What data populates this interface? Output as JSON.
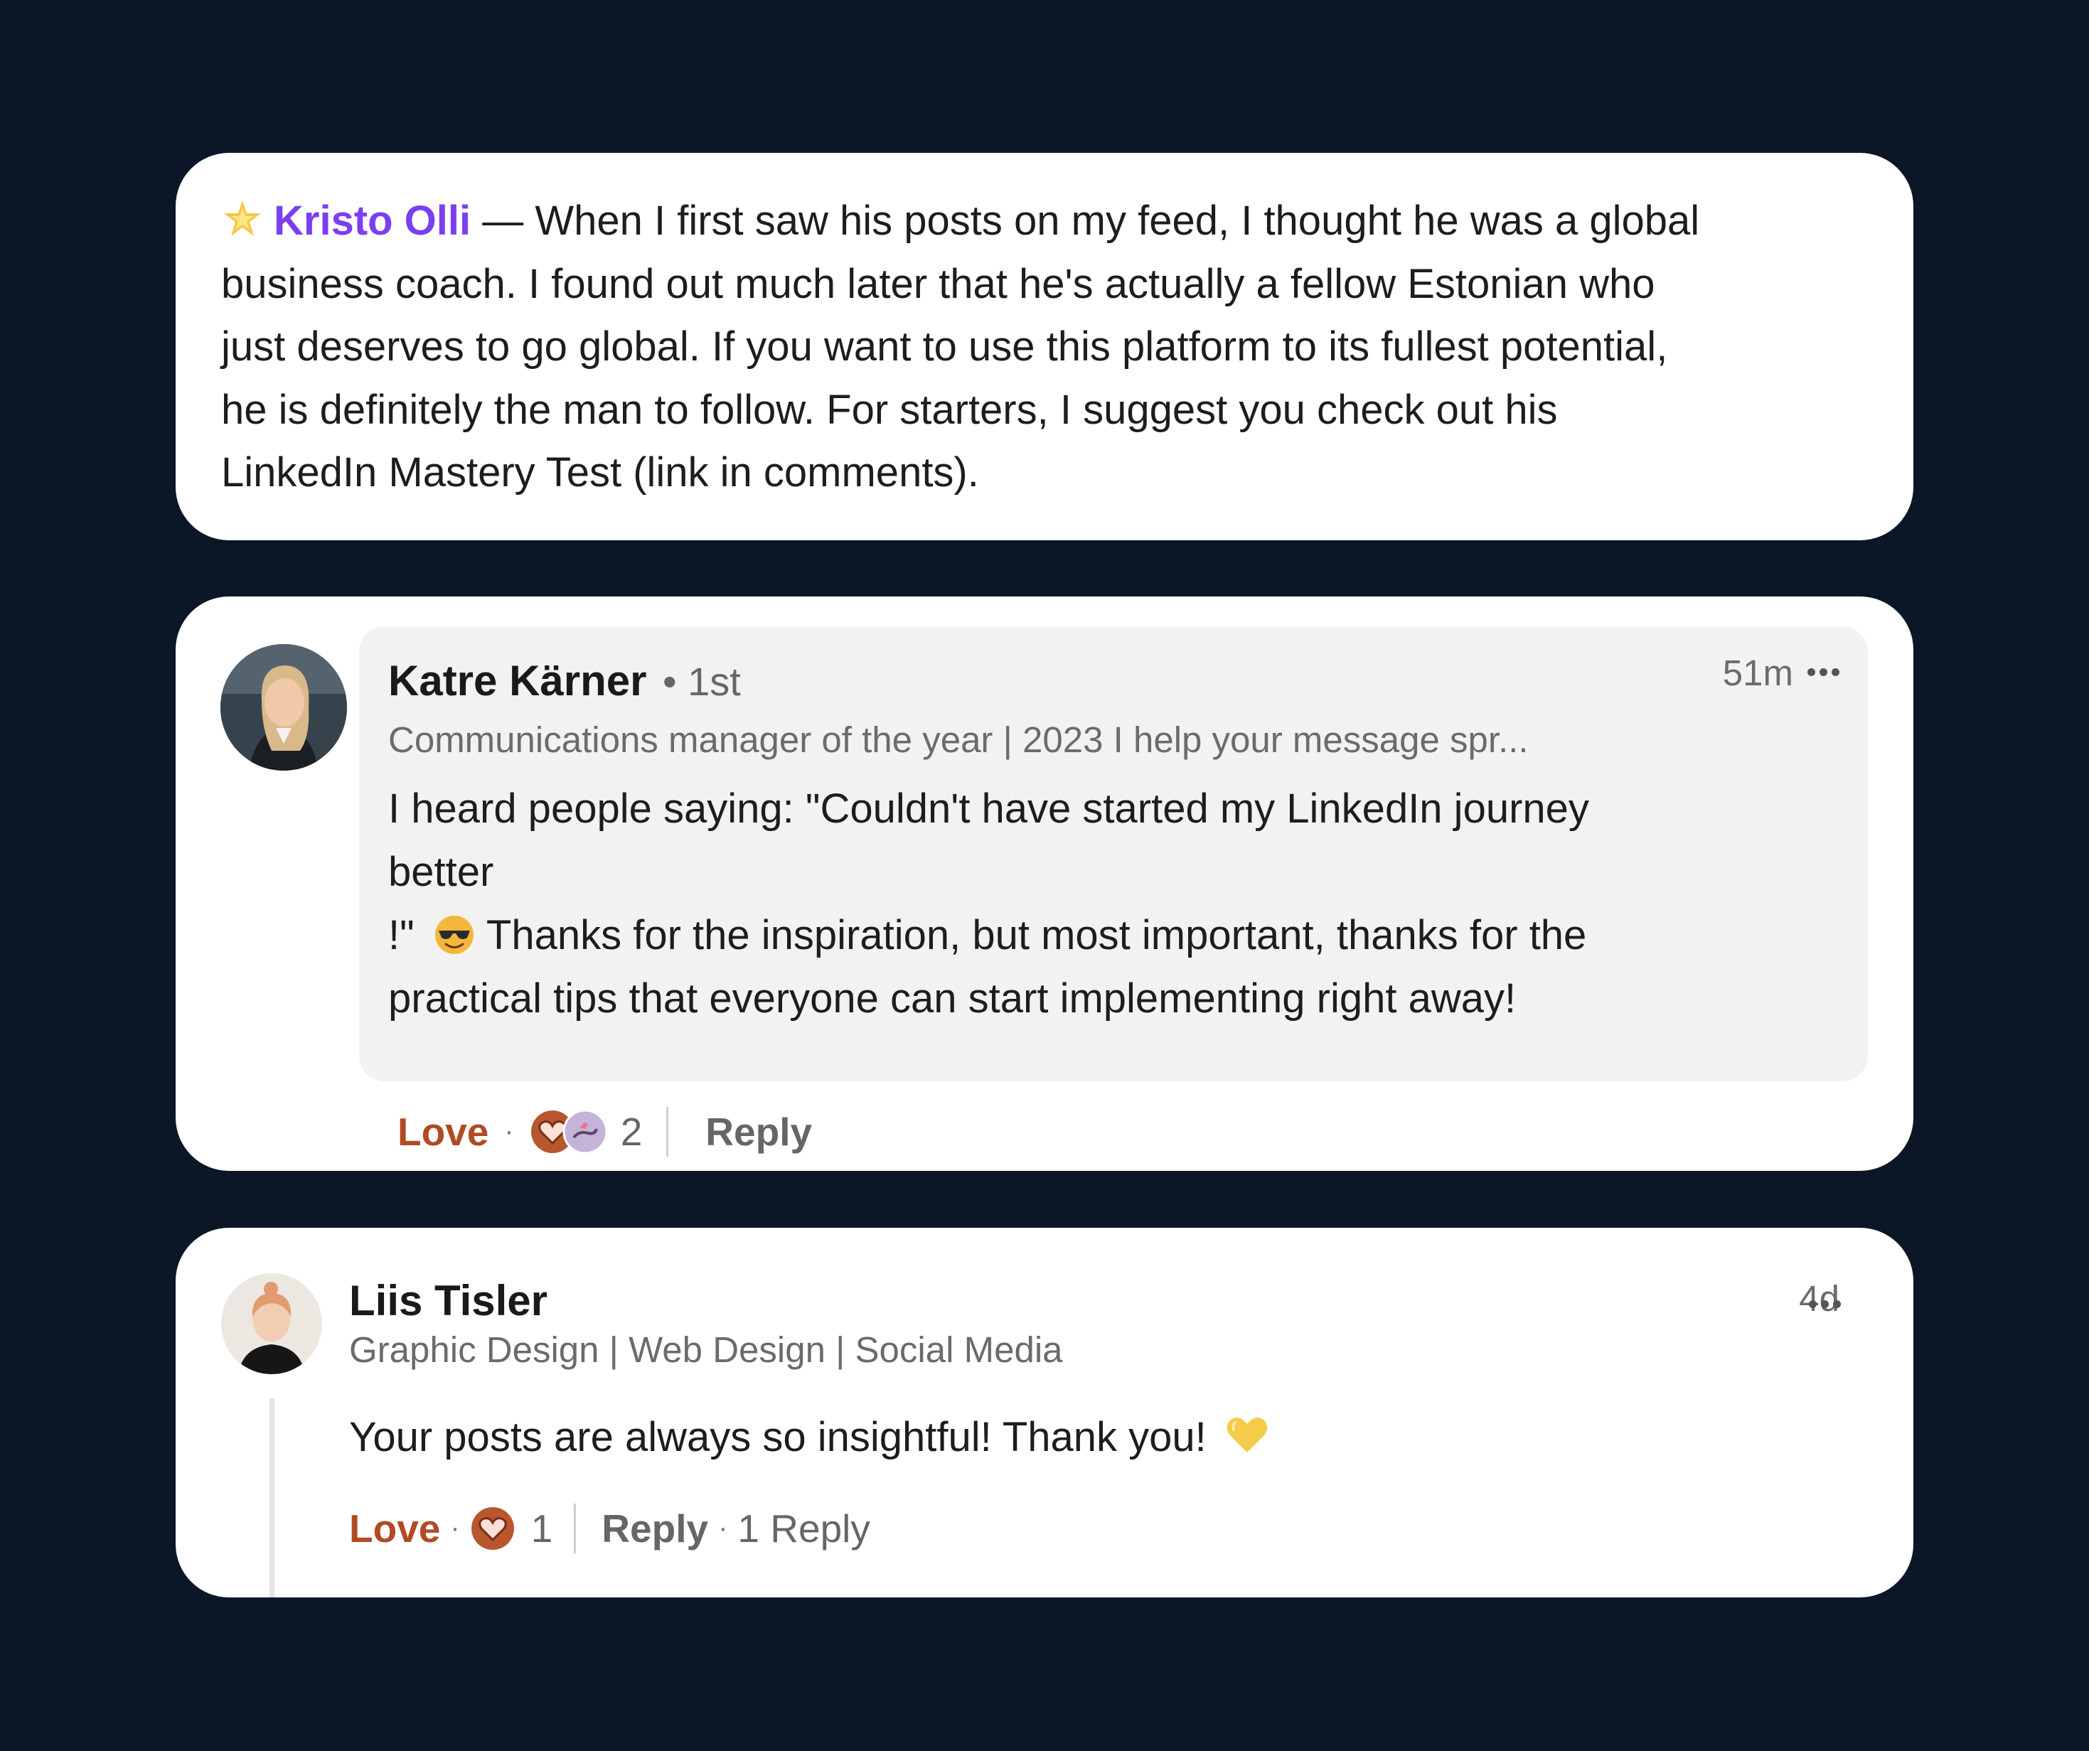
{
  "card1": {
    "mention_name": "Kristo Olli",
    "star_icon": "star-sparkle-icon",
    "lines": [
      " — When I first saw his posts on my feed, I thought he was a global",
      "business coach. I found out much later that he's actually a fellow Estonian who",
      "just deserves to go global. If you want to use this platform to its fullest potential,",
      "he is definitely the man to follow. For starters, I suggest you check out his",
      "LinkedIn Mastery Test (link in comments)."
    ]
  },
  "comment1": {
    "author": "Katre Kärner",
    "degree": "• 1st",
    "headline": "Communications manager of the year | 2023 I help your message spr...",
    "time": "51m",
    "lines": [
      "I heard people saying: \"Couldn't have started my LinkedIn journey",
      "better",
      " Thanks for the inspiration, but most important, thanks for the",
      "practical tips that everyone can start implementing right away!"
    ],
    "line3_prefix": "!\"",
    "emoji": "smiling-face-with-sunglasses-icon",
    "love_label": "Love",
    "reaction_count": "2",
    "reply_label": "Reply",
    "dot": "·"
  },
  "comment2": {
    "author": "Liis Tisler",
    "headline": "Graphic Design | Web Design | Social Media",
    "time": "4d",
    "text": "Your posts are always so insightful! Thank you!",
    "emoji": "yellow-heart-icon",
    "love_label": "Love",
    "reaction_count": "1",
    "reply_label": "Reply",
    "replies_label": "1 Reply",
    "dot": "·"
  },
  "colors": {
    "background": "#0b1727",
    "mention": "#7a3ff0",
    "love": "#b24a24",
    "bubble": "#f2f2f2"
  }
}
